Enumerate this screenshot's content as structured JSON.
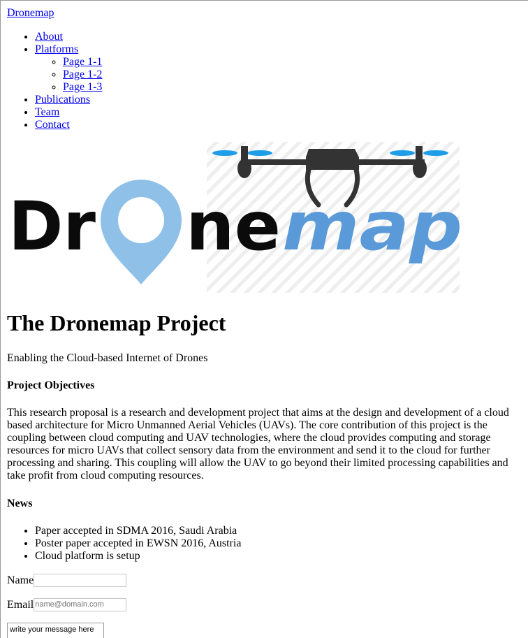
{
  "nav": {
    "brand": "Dronemap",
    "items": [
      {
        "label": "About"
      },
      {
        "label": "Platforms",
        "children": [
          {
            "label": "Page 1-1"
          },
          {
            "label": "Page 1-2"
          },
          {
            "label": "Page 1-3"
          }
        ]
      },
      {
        "label": "Publications"
      },
      {
        "label": "Team"
      },
      {
        "label": "Contact"
      }
    ]
  },
  "logo": {
    "text_dark": "Dr",
    "text_dark2": "ne",
    "text_blue": "map",
    "color_dark": "#0b0b0b",
    "color_blue": "#5b9ad8",
    "color_pin": "#8fc1e8",
    "color_propeller": "#1e9de8",
    "color_drone": "#333333"
  },
  "main": {
    "title": "The Dronemap Project",
    "tagline": "Enabling the Cloud-based Internet of Drones",
    "objectives_heading": "Project Objectives",
    "objectives_text": "This research proposal is a research and development project that aims at the design and development of a cloud based architecture for Micro Unmanned Aerial Vehicles (UAVs). The core contribution of this project is the coupling between cloud computing and UAV technologies, where the cloud provides computing and storage resources for micro UAVs that collect sensory data from the environment and send it to the cloud for further processing and sharing. This coupling will allow the UAV to go beyond their limited processing capabilities and take profit from cloud computing resources.",
    "news_heading": "News",
    "news": [
      "Paper accepted in SDMA 2016, Saudi Arabia",
      "Poster paper accepted in EWSN 2016, Austria",
      "Cloud platform is setup"
    ]
  },
  "form": {
    "name_label": "Name",
    "name_value": "",
    "email_label": "Email",
    "email_placeholder": "name@domain.com",
    "message_placeholder": "write your message here"
  }
}
